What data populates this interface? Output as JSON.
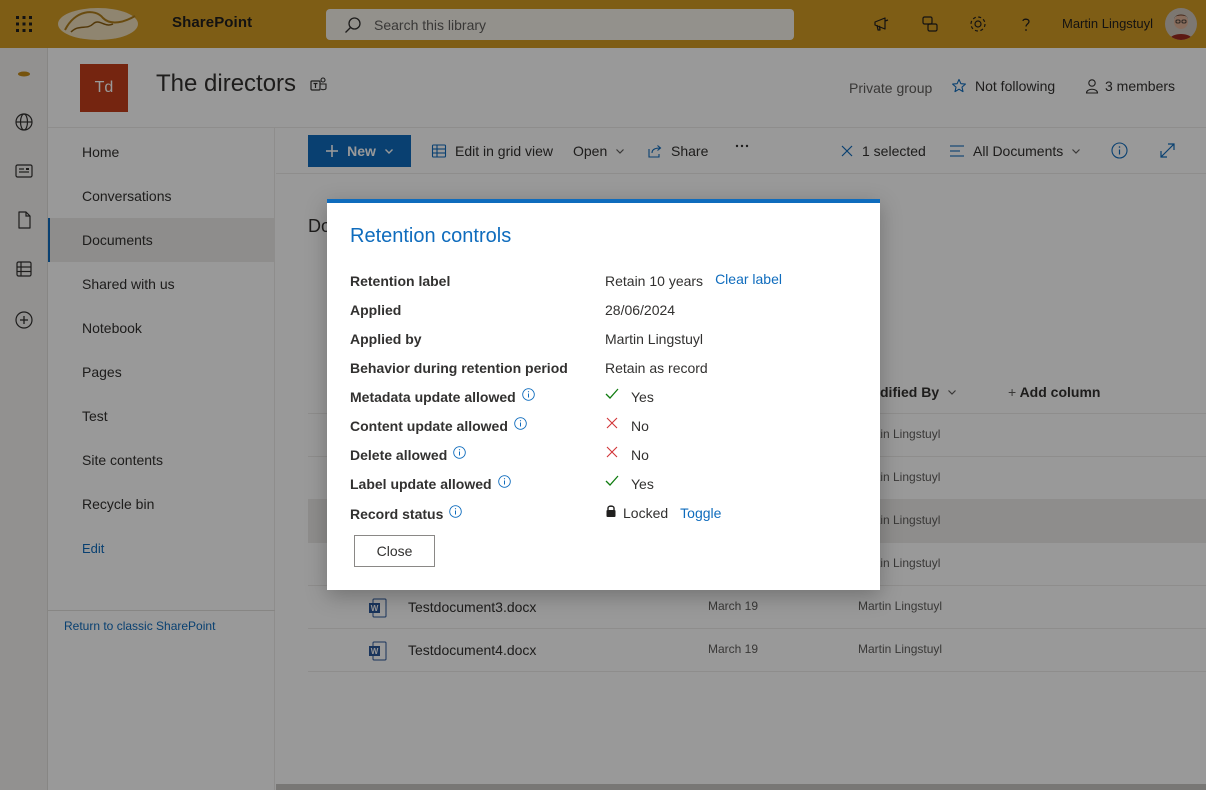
{
  "suite": {
    "app_name": "SharePoint",
    "search_placeholder": "Search this library",
    "user_name": "Martin Lingstuyl"
  },
  "site": {
    "logo_initials": "Td",
    "title": "The directors",
    "privacy": "Private group",
    "follow_label": "Not following",
    "members_label": "3 members"
  },
  "nav": {
    "items": [
      {
        "label": "Home"
      },
      {
        "label": "Conversations"
      },
      {
        "label": "Documents"
      },
      {
        "label": "Shared with us"
      },
      {
        "label": "Notebook"
      },
      {
        "label": "Pages"
      },
      {
        "label": "Test"
      },
      {
        "label": "Site contents"
      },
      {
        "label": "Recycle bin"
      }
    ],
    "edit_label": "Edit",
    "classic_link": "Return to classic SharePoint"
  },
  "commandbar": {
    "new_label": "New",
    "grid_label": "Edit in grid view",
    "open_label": "Open",
    "share_label": "Share",
    "selected_label": "1 selected",
    "view_label": "All Documents"
  },
  "library": {
    "title_partial": "Do",
    "columns": {
      "modified_by": "dified By",
      "add_column": "Add column"
    },
    "rows": [
      {
        "name": "",
        "date": "",
        "by": "rtin Lingstuyl"
      },
      {
        "name": "",
        "date": "",
        "by": "rtin Lingstuyl"
      },
      {
        "name": "",
        "date": "",
        "by": "rtin Lingstuyl"
      },
      {
        "name": "",
        "date": "",
        "by": "rtin Lingstuyl"
      },
      {
        "name": "Testdocument3.docx",
        "date": "March 19",
        "by": "Martin Lingstuyl"
      },
      {
        "name": "Testdocument4.docx",
        "date": "March 19",
        "by": "Martin Lingstuyl"
      }
    ]
  },
  "dialog": {
    "title": "Retention controls",
    "retention_label": {
      "label": "Retention label",
      "value": "Retain 10 years",
      "link": "Clear label"
    },
    "applied": {
      "label": "Applied",
      "value": "28/06/2024"
    },
    "applied_by": {
      "label": "Applied by",
      "value": "Martin Lingstuyl"
    },
    "behavior": {
      "label": "Behavior during retention period",
      "value": "Retain as record"
    },
    "metadata_update": {
      "label": "Metadata update allowed",
      "value": "Yes"
    },
    "content_update": {
      "label": "Content update allowed",
      "value": "No"
    },
    "delete_allowed": {
      "label": "Delete allowed",
      "value": "No"
    },
    "label_update": {
      "label": "Label update allowed",
      "value": "Yes"
    },
    "record_status": {
      "label": "Record status",
      "value": "Locked",
      "link": "Toggle"
    },
    "close_label": "Close"
  },
  "colors": {
    "suite_bar": "#d39b24",
    "accent": "#0f6cbd",
    "site_logo": "#c43e1c",
    "yes_check": "#107c10",
    "no_cross": "#d13438"
  }
}
